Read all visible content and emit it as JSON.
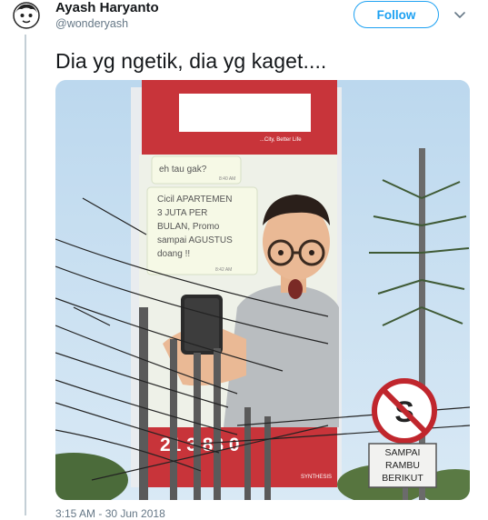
{
  "author": {
    "name": "Ayash Haryanto",
    "handle": "@wonderyash"
  },
  "follow_label": "Follow",
  "tweet_text": "Dia yg ngetik, dia yg kaget....",
  "billboard": {
    "tagline": "...City, Better Life",
    "chat_question": "eh tau gak?",
    "chat_question_time": "8:40 AM",
    "chat_answer_lines": [
      "Cicil APARTEMEN",
      "3 JUTA PER",
      "BULAN, Promo",
      "sampai AGUSTUS",
      "doang !!"
    ],
    "chat_answer_time": "8:42 AM",
    "phone_number": "21 3 88 0",
    "brand": "SYNTHESIS"
  },
  "road_sign": {
    "letter": "S",
    "plate_lines": [
      "SAMPAI",
      "RAMBU",
      "BERIKUT"
    ]
  },
  "timestamp": "3:15 AM - 30 Jun 2018",
  "colors": {
    "follow_blue": "#1da1f2",
    "name_text": "#14171a",
    "muted_text": "#657786",
    "billboard_red": "#c8343a"
  },
  "icons": [
    "avatar",
    "chevron-down-icon"
  ]
}
